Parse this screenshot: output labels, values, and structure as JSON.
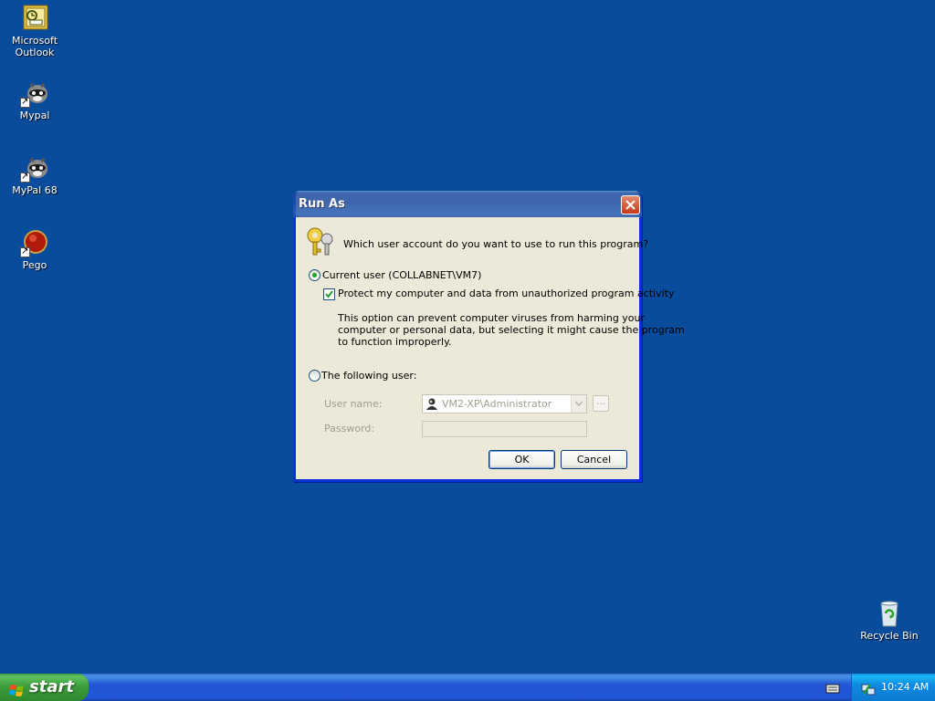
{
  "desktop": {
    "icons": [
      {
        "label_line1": "Microsoft",
        "label_line2": "Outlook",
        "icon": "outlook-icon"
      },
      {
        "label_line1": "Mypal",
        "icon": "mypal-icon"
      },
      {
        "label_line1": "MyPal 68",
        "icon": "mypal-icon"
      },
      {
        "label_line1": "Pego",
        "icon": "pego-icon"
      }
    ],
    "recycle_bin": {
      "label": "Recycle Bin",
      "icon": "recycle-bin-icon"
    },
    "background_color": "#0a4c9c"
  },
  "dialog": {
    "title": "Run As",
    "prompt": "Which user account do you want to use to run this program?",
    "option_current_user": {
      "label": "Current user (COLLABNET\\VM7)",
      "selected": true
    },
    "protect_checkbox": {
      "label": "Protect my computer and data from unauthorized program activity",
      "checked": true
    },
    "description_line1": "This option can prevent computer viruses from harming your",
    "description_line2": "computer or personal data, but selecting it might cause the program",
    "description_line3": "to function improperly.",
    "option_following_user": {
      "label": "The following user:",
      "selected": false
    },
    "user_name_label": "User name:",
    "user_name_value": "VM2-XP\\Administrator",
    "browse_label": "...",
    "password_label": "Password:",
    "password_value": "",
    "ok_label": "OK",
    "cancel_label": "Cancel"
  },
  "taskbar": {
    "start_label": "start",
    "clock": "10:24 AM"
  }
}
